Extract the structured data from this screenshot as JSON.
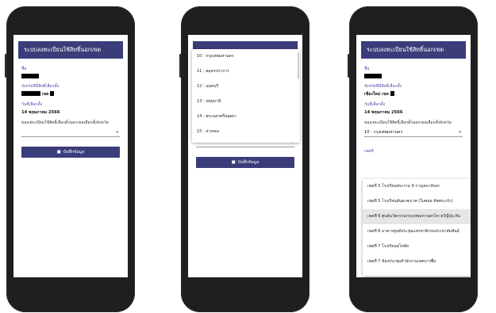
{
  "app": {
    "title": "ระบบลงทะเบียนใช้สิทธิ์นอกเขต"
  },
  "form": {
    "name_label": "ชื่อ",
    "province_label": "จังหวัดที่มีสิทธิ์เลือกตั้ง",
    "province_value_phone1": "เขต",
    "province_value_phone3": "เชียงใหม่ เขต",
    "date_label": "วันที่เลือกตั้ง",
    "date_value": "14 พฤษภาคม 2566",
    "register_label": "ขอลงทะเบียนใช้สิทธิ์เลือกตั้งนอกเขตเลือกตั้งจังหวัด",
    "selected_province": "10 : กรุงเทพมหานคร",
    "district_label": "เขตที่",
    "save_label": "บันทึกข้อมูล",
    "save_icon": "save-icon"
  },
  "province_options": [
    "10 : กรุงเทพมหานคร",
    "11 : สมุทรปราการ",
    "12 : นนทบุรี",
    "13 : ปทุมธานี",
    "14 : พระนครศรีอยุธยา",
    "15 : อ่างทอง"
  ],
  "district_options": [
    "เขตที่ 5 โรงเรียนพระราม 9 กาญจนาภิเษก",
    "เขตที่ 5 โรงเรียนสันตะพรเวศ (ในซอย ทัพพระเจ้า)",
    "เขตที่ 6 ศูนย์นวัตกรรมกรุงเทพมหานครไท–ยวีญี่ปุ่น ดิน",
    "เขตที่ 6 อาคารศูนย์ประชุมแห่งชาติกรมประชาสัมพันธ์",
    "เขตที่ 7 โรงเรียนสุโขทัย",
    "เขตที่ 7 ห้องประชุมสำนักงานเขตบางซื่อ"
  ],
  "colors": {
    "appbar": "#3b3d7a",
    "label": "#4a4aa8",
    "phone_body": "#1f1f22"
  }
}
